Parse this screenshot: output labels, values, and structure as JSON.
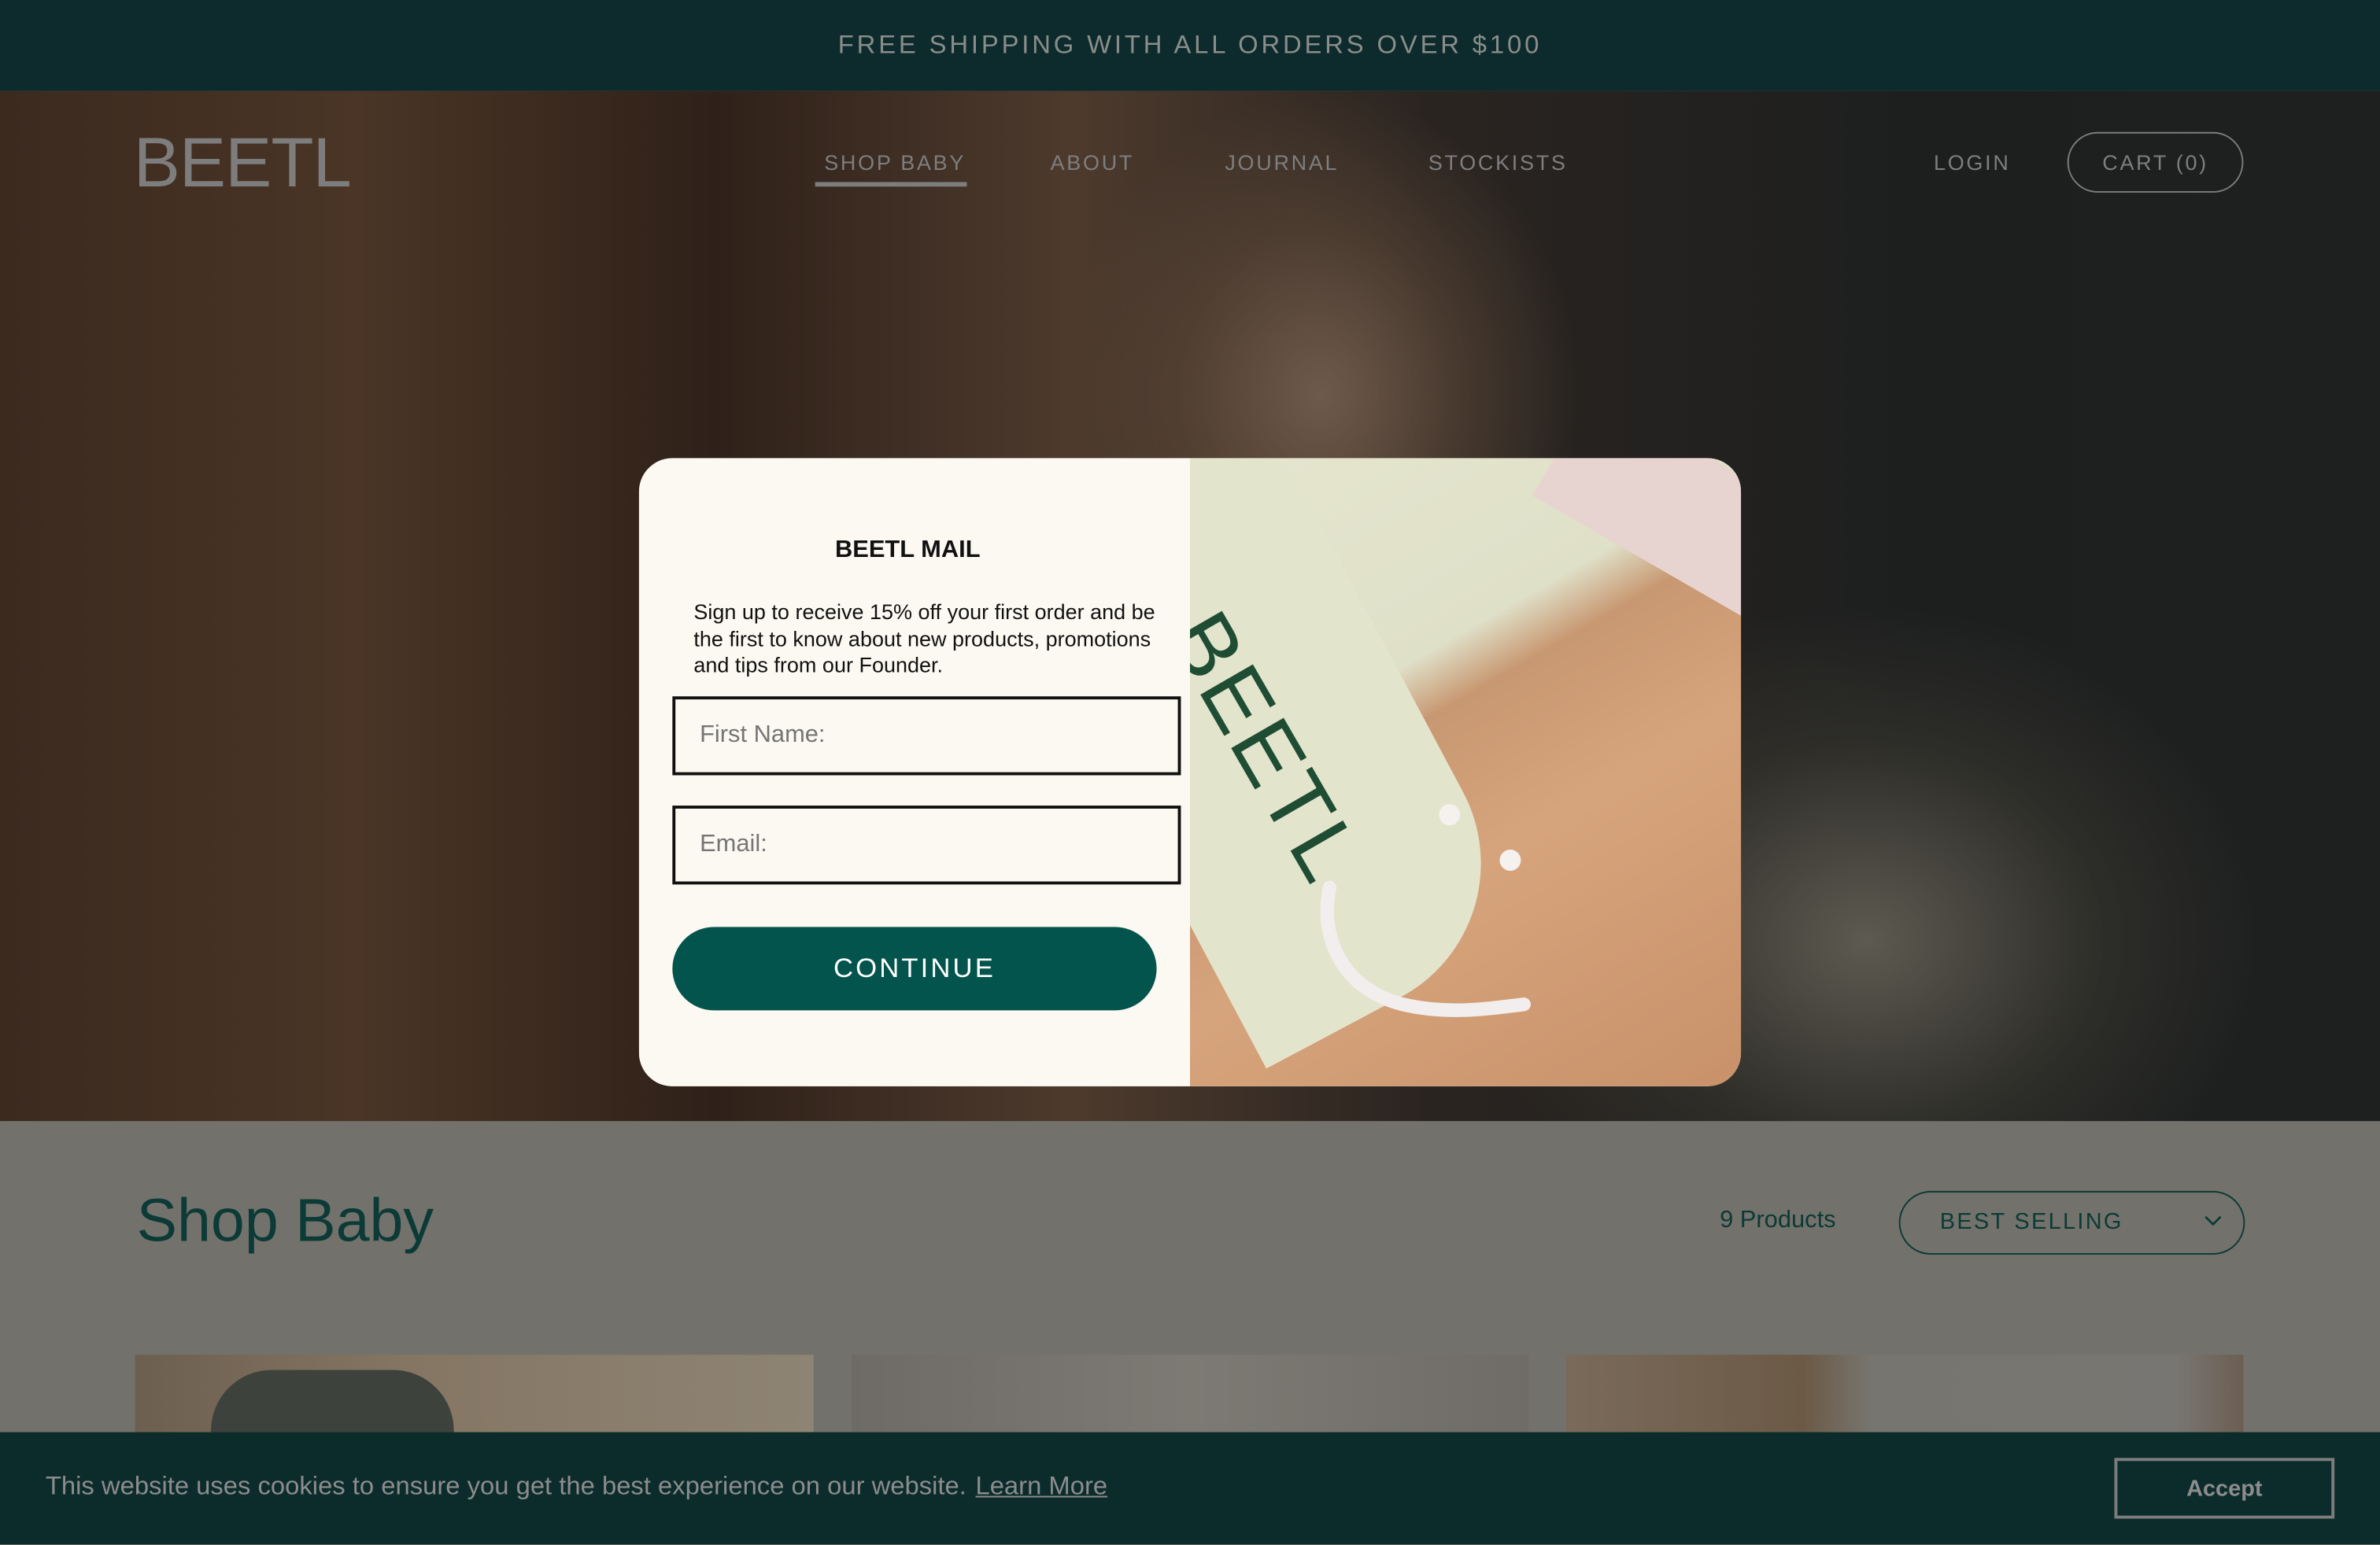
{
  "announcement": "FREE SHIPPING WITH ALL ORDERS OVER $100",
  "header": {
    "logo": "BEETL",
    "nav": [
      "SHOP BABY",
      "ABOUT",
      "JOURNAL",
      "STOCKISTS"
    ],
    "active_nav": "SHOP BABY",
    "login": "LOGIN",
    "cart": "CART (0)"
  },
  "collection": {
    "title": "Shop Baby",
    "count": "9 Products",
    "sort": {
      "selected": "BEST SELLING",
      "icon": "chevron-down-icon"
    }
  },
  "popup": {
    "title": "BEETL MAIL",
    "body": "Sign up to receive 15% off your first order and be the first to know about new products, promotions and tips from our Founder.",
    "first_name_placeholder": "First Name:",
    "email_placeholder": "Email:",
    "continue": "CONTINUE",
    "image_label": "BEETL",
    "close_icon": "close-icon"
  },
  "cookie": {
    "text": "This website uses cookies to ensure you get the best experience on our website.",
    "learn_more": "Learn More",
    "accept": "Accept"
  },
  "colors": {
    "brand_dark": "#0d2b2c",
    "button": "#02544c",
    "popup_bg": "#fbf9f1",
    "title_green": "#0c3a36"
  }
}
